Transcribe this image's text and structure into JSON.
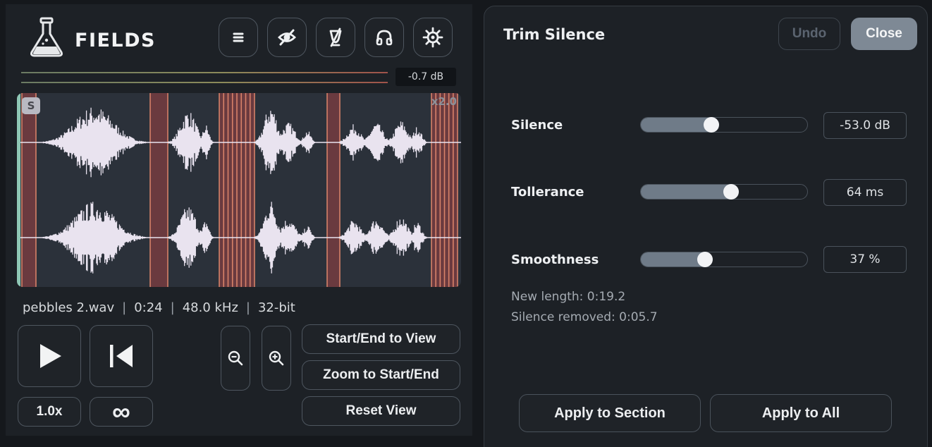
{
  "app": {
    "name": "FIELDS"
  },
  "toolbar": {
    "icons": [
      "menu-icon",
      "eye-hidden-icon",
      "no-filter-icon",
      "headphones-icon",
      "settings-gear-icon"
    ]
  },
  "meter": {
    "peak_label": "-0.7 dB"
  },
  "waveform": {
    "solo_badge": "S",
    "zoom_label": "x2.0",
    "colors": {
      "background": "#2b313a",
      "wave": "#e9e3ef",
      "silence_region": "#6a3a3f",
      "silence_marker": "#e58a6e",
      "start_marker": "#8fc7b5"
    }
  },
  "file_info": {
    "name": "pebbles 2.wav",
    "duration": "0:24",
    "sample_rate": "48.0 kHz",
    "bit_depth": "32-bit",
    "separator": "|"
  },
  "transport": {
    "play_icon": "play-icon",
    "rewind_icon": "skip-to-start-icon",
    "speed_label": "1.0x",
    "loop_label": "∞"
  },
  "view": {
    "zoom_out_icon": "zoom-out-icon",
    "zoom_in_icon": "zoom-in-icon",
    "start_end_to_view": "Start/End to View",
    "zoom_to_start_end": "Zoom to Start/End",
    "reset_view": "Reset View"
  },
  "trim_panel": {
    "title": "Trim Silence",
    "undo_label": "Undo",
    "close_label": "Close",
    "params": [
      {
        "label": "Silence",
        "value_text": "-53.0 dB",
        "level": 0.41
      },
      {
        "label": "Tollerance",
        "value_text": "64 ms",
        "level": 0.54
      },
      {
        "label": "Smoothness",
        "value_text": "37 %",
        "level": 0.37
      }
    ],
    "new_length": "New length: 0:19.2",
    "silence_removed": "Silence removed: 0:05.7",
    "apply_section": "Apply to Section",
    "apply_all": "Apply to All"
  }
}
